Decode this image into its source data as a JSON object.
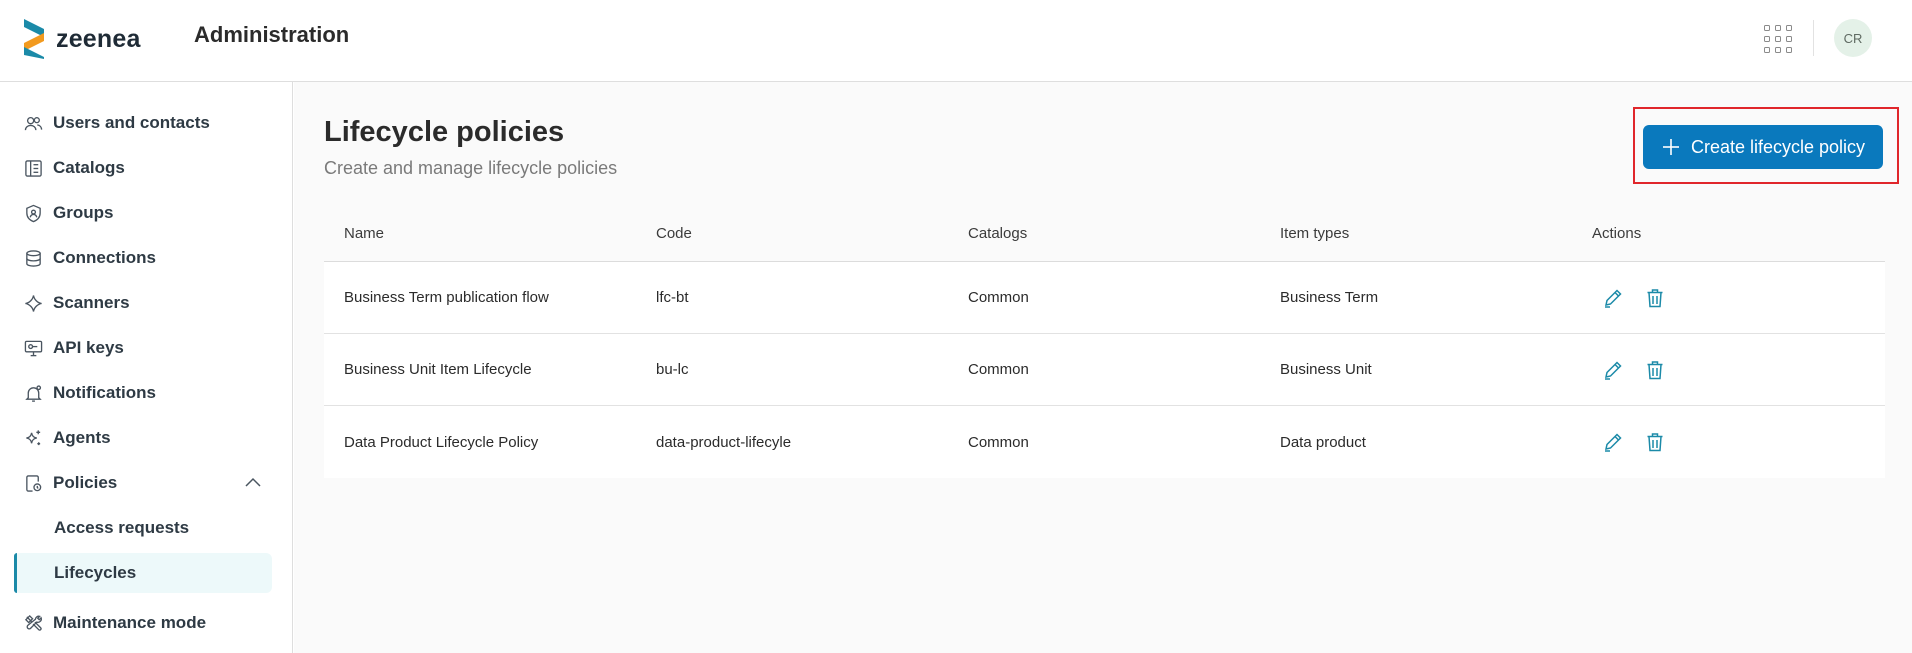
{
  "header": {
    "logo_text": "zeenea",
    "app_title": "Administration",
    "apps_icon": "grid-apps-icon",
    "avatar_initials": "CR"
  },
  "sidebar": {
    "items": [
      {
        "label": "Users and contacts",
        "icon": "users-icon"
      },
      {
        "label": "Catalogs",
        "icon": "catalog-icon"
      },
      {
        "label": "Groups",
        "icon": "shield-group-icon"
      },
      {
        "label": "Connections",
        "icon": "database-icon"
      },
      {
        "label": "Scanners",
        "icon": "scanner-icon"
      },
      {
        "label": "API keys",
        "icon": "api-key-icon"
      },
      {
        "label": "Notifications",
        "icon": "bell-icon"
      },
      {
        "label": "Agents",
        "icon": "sparkle-icon"
      },
      {
        "label": "Policies",
        "icon": "policy-icon"
      },
      {
        "label": "Maintenance mode",
        "icon": "tools-icon"
      }
    ],
    "policies_children": [
      {
        "label": "Access requests"
      },
      {
        "label": "Lifecycles",
        "active": true
      }
    ]
  },
  "main": {
    "title": "Lifecycle policies",
    "subtitle": "Create and manage lifecycle policies",
    "create_button_label": "Create lifecycle policy",
    "table": {
      "headers": [
        "Name",
        "Code",
        "Catalogs",
        "Item types",
        "Actions"
      ],
      "rows": [
        {
          "name": "Business Term publication flow",
          "code": "lfc-bt",
          "catalogs": "Common",
          "item_types": "Business Term"
        },
        {
          "name": "Business Unit Item Lifecycle",
          "code": "bu-lc",
          "catalogs": "Common",
          "item_types": "Business Unit"
        },
        {
          "name": "Data Product Lifecycle Policy",
          "code": "data-product-lifecyle",
          "catalogs": "Common",
          "item_types": "Data product"
        }
      ]
    }
  },
  "colors": {
    "primary_button": "#0a79bd",
    "highlight_border": "#e0262b",
    "active_nav_bg": "#edf9fa",
    "action_icon": "#1b8aa8"
  }
}
